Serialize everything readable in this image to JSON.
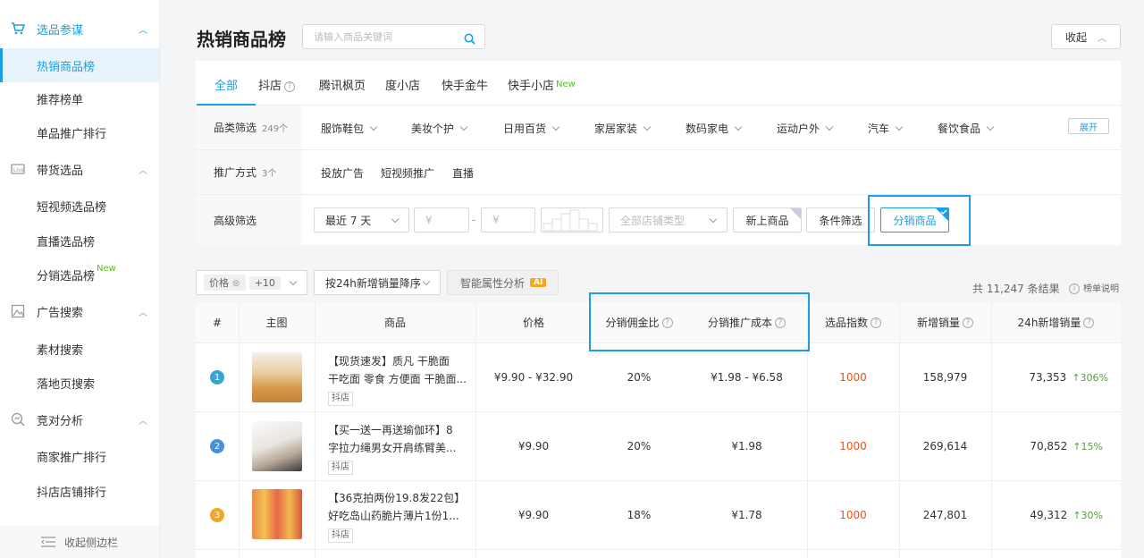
{
  "sidebar": {
    "sections": [
      {
        "label": "选品参谋",
        "items": [
          "热销商品榜",
          "推荐榜单",
          "单品推广排行"
        ]
      },
      {
        "label": "带货选品",
        "items": [
          "短视频选品榜",
          "直播选品榜",
          "分销选品榜"
        ]
      },
      {
        "label": "广告搜索",
        "items": [
          "素材搜索",
          "落地页搜索"
        ]
      },
      {
        "label": "竞对分析",
        "items": [
          "商家推广排行",
          "抖店店铺排行"
        ]
      }
    ],
    "new_badge": "New",
    "collapse_label": "收起侧边栏"
  },
  "page": {
    "title": "热销商品榜",
    "search_placeholder": "请输入商品关键词",
    "collapse_label": "收起"
  },
  "tabs": [
    "全部",
    "抖店",
    "腾讯枫页",
    "度小店",
    "快手金牛",
    "快手小店"
  ],
  "tab_new": "New",
  "filters": {
    "category_label": "品类筛选",
    "category_count": "249个",
    "categories": [
      "服饰鞋包",
      "美妆个护",
      "日用百货",
      "家居家装",
      "数码家电",
      "运动户外",
      "汽车",
      "餐饮食品"
    ],
    "expand": "展开",
    "promo_label": "推广方式",
    "promo_count": "3个",
    "promo_opts": [
      "投放广告",
      "短视频推广",
      "直播"
    ],
    "adv_label": "高级筛选",
    "period": "最近 7 天",
    "price_min": "¥",
    "price_dash": "-",
    "price_max": "¥",
    "shop_type": "全部店铺类型",
    "new_btn": "新上商品",
    "cond_btn": "条件筛选",
    "dist_btn": "分销商品"
  },
  "toolbar": {
    "chip_price": "价格",
    "chip_more": "+10",
    "sort": "按24h新增销量降序",
    "ai": "智能属性分析",
    "ai_tag": "AI",
    "total": "共 11,247 条结果",
    "help": "榜单说明"
  },
  "table": {
    "headers": [
      "#",
      "主图",
      "商品",
      "价格",
      "分销佣金比",
      "分销推广成本",
      "选品指数",
      "新增销量",
      "24h新增销量"
    ],
    "rows": [
      {
        "rank": "1",
        "name1": "【现货速发】质凡 干脆面",
        "name2": "干吃面 零食 方便面 干脆面...",
        "tag": "抖店",
        "price": "¥9.90 - ¥32.90",
        "ratio": "20%",
        "cost": "¥1.98 - ¥6.58",
        "index": "1000",
        "sales": "158,979",
        "s24": "73,353",
        "growth": "306%"
      },
      {
        "rank": "2",
        "name1": "【买一送一再送瑜伽环】8",
        "name2": "字拉力绳男女开肩练臂美...",
        "tag": "抖店",
        "price": "¥9.90",
        "ratio": "20%",
        "cost": "¥1.98",
        "index": "1000",
        "sales": "269,614",
        "s24": "70,852",
        "growth": "15%"
      },
      {
        "rank": "3",
        "name1": "【36克拍两份19.8发22包】",
        "name2": "好吃岛山药脆片薄片1份1...",
        "tag": "抖店",
        "price": "¥9.90",
        "ratio": "18%",
        "cost": "¥1.78",
        "index": "1000",
        "sales": "247,801",
        "s24": "49,312",
        "growth": "30%"
      }
    ]
  },
  "colors": {
    "accent": "#1b9ee3",
    "rank1": "#36a3d9",
    "rank2": "#4a90d9",
    "rank3": "#f5a623",
    "index": "#e8541e",
    "growth": "#52a33a"
  }
}
